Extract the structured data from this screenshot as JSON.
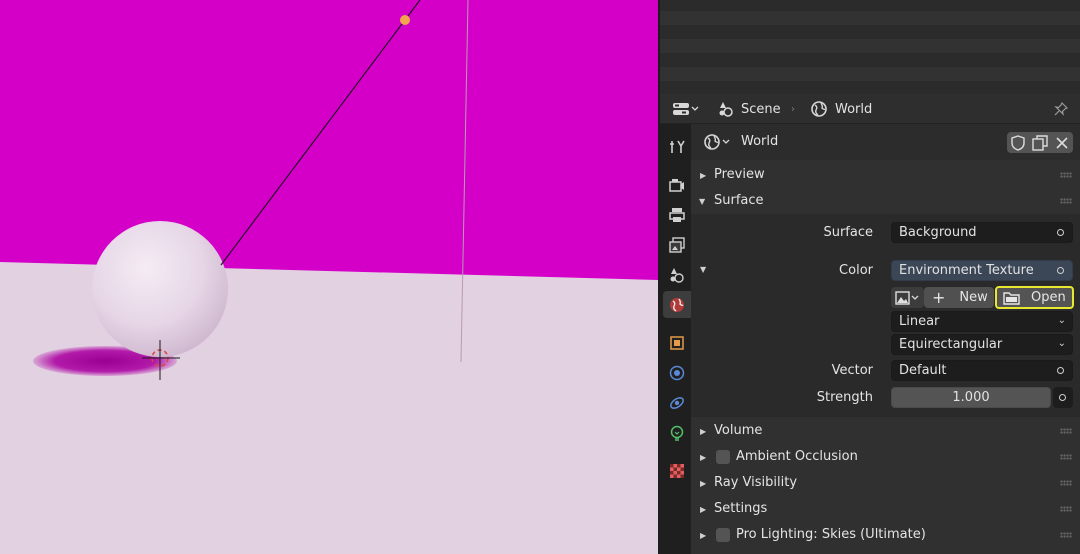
{
  "header": {
    "breadcrumb_scene": "Scene",
    "breadcrumb_world": "World"
  },
  "datablock": {
    "name": "World"
  },
  "panels": {
    "preview": "Preview",
    "surface": "Surface",
    "volume": "Volume",
    "ambient_occlusion": "Ambient Occlusion",
    "ray_visibility": "Ray Visibility",
    "settings": "Settings",
    "pro_lighting": "Pro Lighting: Skies (Ultimate)"
  },
  "surface": {
    "surface_label": "Surface",
    "surface_value": "Background",
    "color_label": "Color",
    "color_value": "Environment Texture",
    "new_label": "New",
    "open_label": "Open",
    "interpolation": "Linear",
    "projection": "Equirectangular",
    "vector_label": "Vector",
    "vector_value": "Default",
    "strength_label": "Strength",
    "strength_value": "1.000"
  },
  "colors": {
    "background_magenta": "#d400c8",
    "floor": "#e1d1e1",
    "highlight": "#e8e830",
    "panel_bg": "#303030"
  },
  "icons": [
    "editor-type-icon",
    "scene-icon",
    "world-icon",
    "pin-icon",
    "tool-icon",
    "render-icon",
    "output-icon",
    "view-layer-icon",
    "scene-props-icon",
    "world-props-icon",
    "object-icon",
    "modifier-icon",
    "physics-icon",
    "object-data-icon",
    "texture-icon",
    "fake-user-icon",
    "duplicate-icon",
    "unlink-icon",
    "image-browse-icon",
    "plus-icon",
    "folder-icon"
  ]
}
